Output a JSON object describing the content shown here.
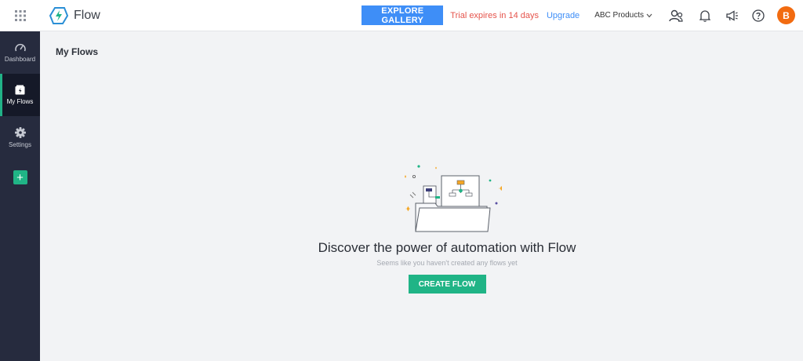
{
  "app": {
    "name": "Flow"
  },
  "header": {
    "explore_label": "EXPLORE GALLERY",
    "trial_text": "Trial expires in 14 days",
    "upgrade_label": "Upgrade",
    "org_name": "ABC Products",
    "avatar_initial": "B"
  },
  "sidebar": {
    "items": [
      {
        "label": "Dashboard",
        "icon": "speedometer-icon"
      },
      {
        "label": "My Flows",
        "icon": "folder-flow-icon"
      },
      {
        "label": "Settings",
        "icon": "gear-icon"
      }
    ],
    "add_label": "+"
  },
  "main": {
    "title": "My Flows",
    "empty_headline": "Discover the power of automation with Flow",
    "empty_sub": "Seems like you haven't created any flows yet",
    "create_label": "CREATE FLOW"
  },
  "colors": {
    "accent_green": "#20b486",
    "primary_blue": "#3e8ef7",
    "trial_red": "#e5534b",
    "sidebar_bg": "#262b3e",
    "avatar_orange": "#f26b10"
  }
}
